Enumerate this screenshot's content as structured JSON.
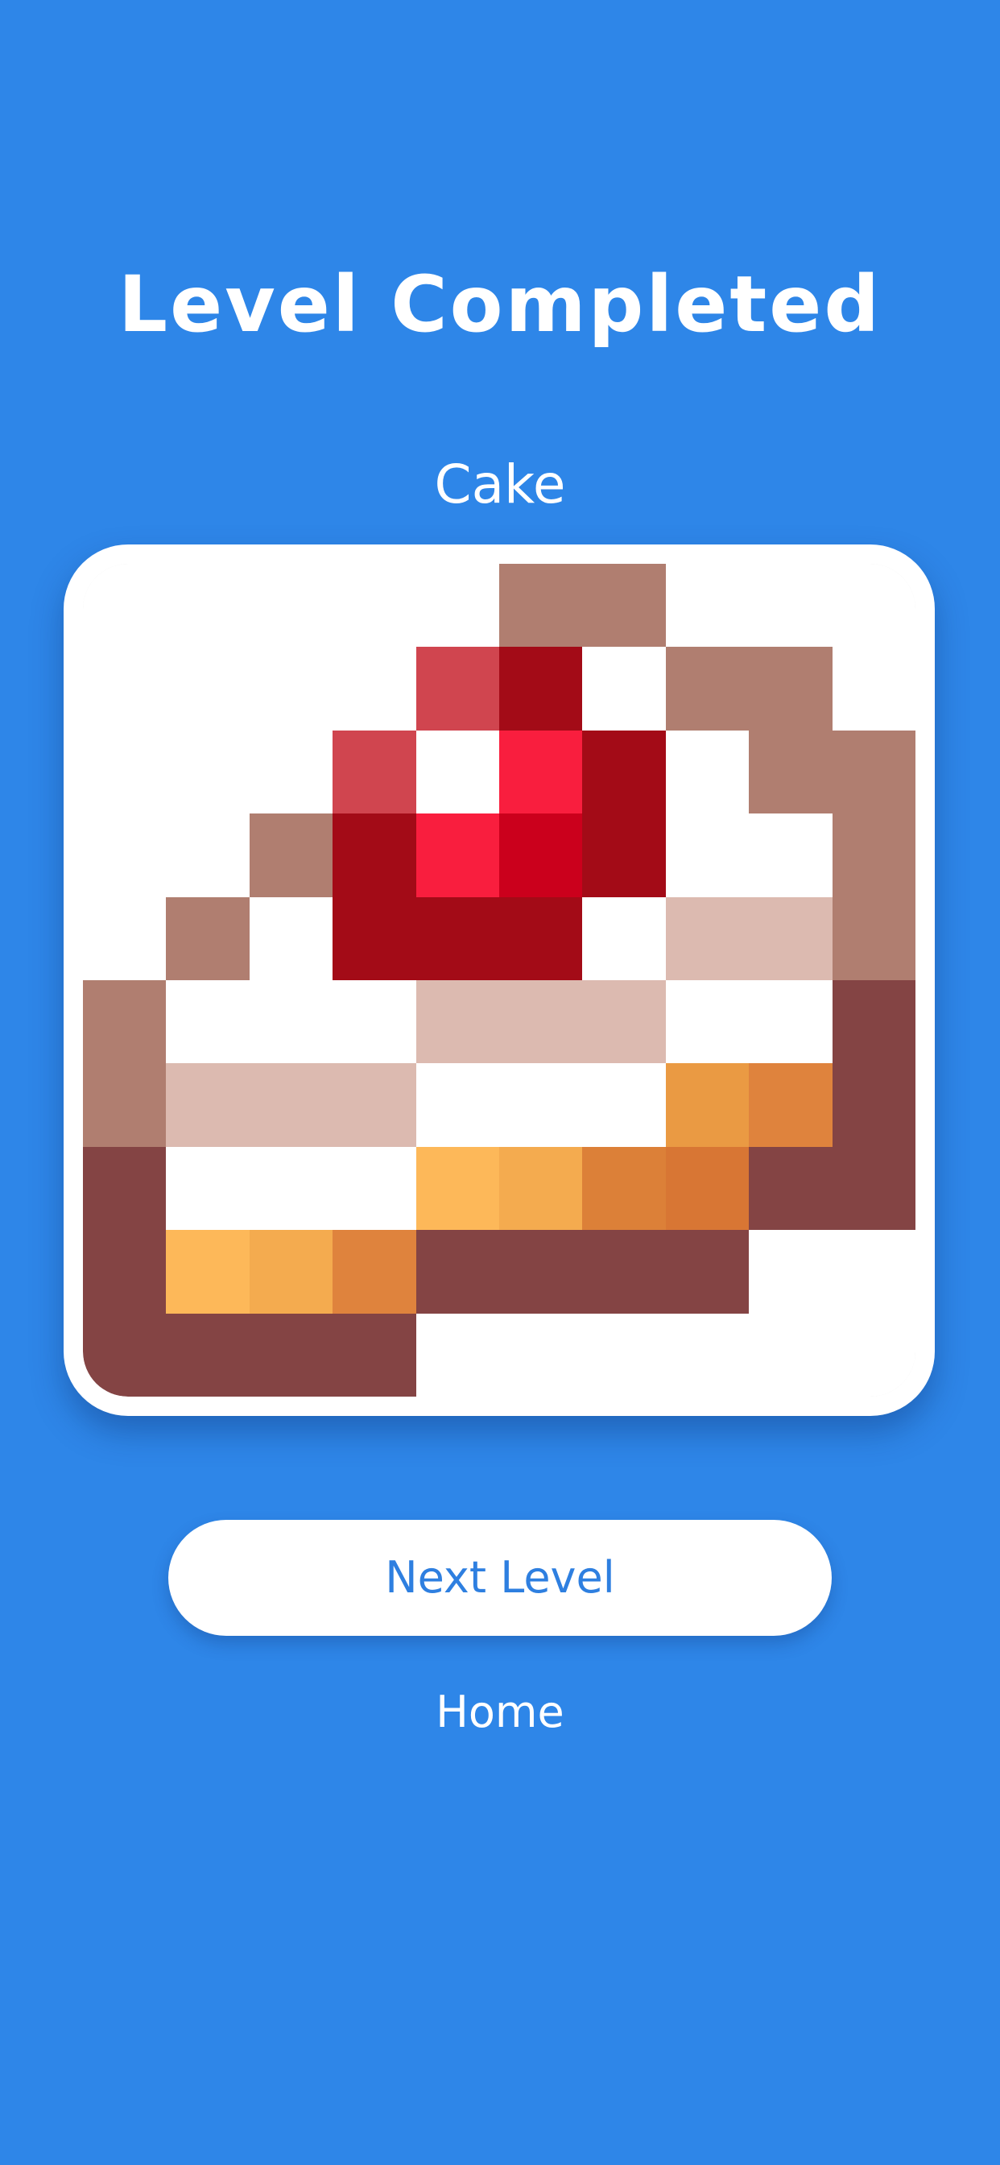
{
  "screen": {
    "title": "Level Completed",
    "level_name": "Cake",
    "background_color": "#2e86e8"
  },
  "buttons": {
    "next_level": "Next Level",
    "home": "Home"
  },
  "artwork": {
    "rows": 10,
    "cols": 10,
    "palette": {
      "W": "#ffffff",
      "M": "#b07e70",
      "P": "#dcbab0",
      "D": "#844444",
      "R": "#a30b17",
      "r": "#cb001c",
      "K": "#f91e3e",
      "S": "#d0454f",
      "Y": "#fdb859",
      "O": "#f4ab4f",
      "o": "#ea9a43",
      "A": "#df833d",
      "B": "#d87634",
      "C": "#dc8038"
    },
    "pixels": [
      "WWWWWMMWWW",
      "WWWWSRWMMW",
      "WWWSWKRWMM",
      "WWMRKrRWWM",
      "WMWRRRWPPM",
      "MWWWPPPWWD",
      "MPPPWWWoAD",
      "DWWWYOCBDD",
      "DYOADDDDWW",
      "DDDDWWWWWW"
    ]
  }
}
